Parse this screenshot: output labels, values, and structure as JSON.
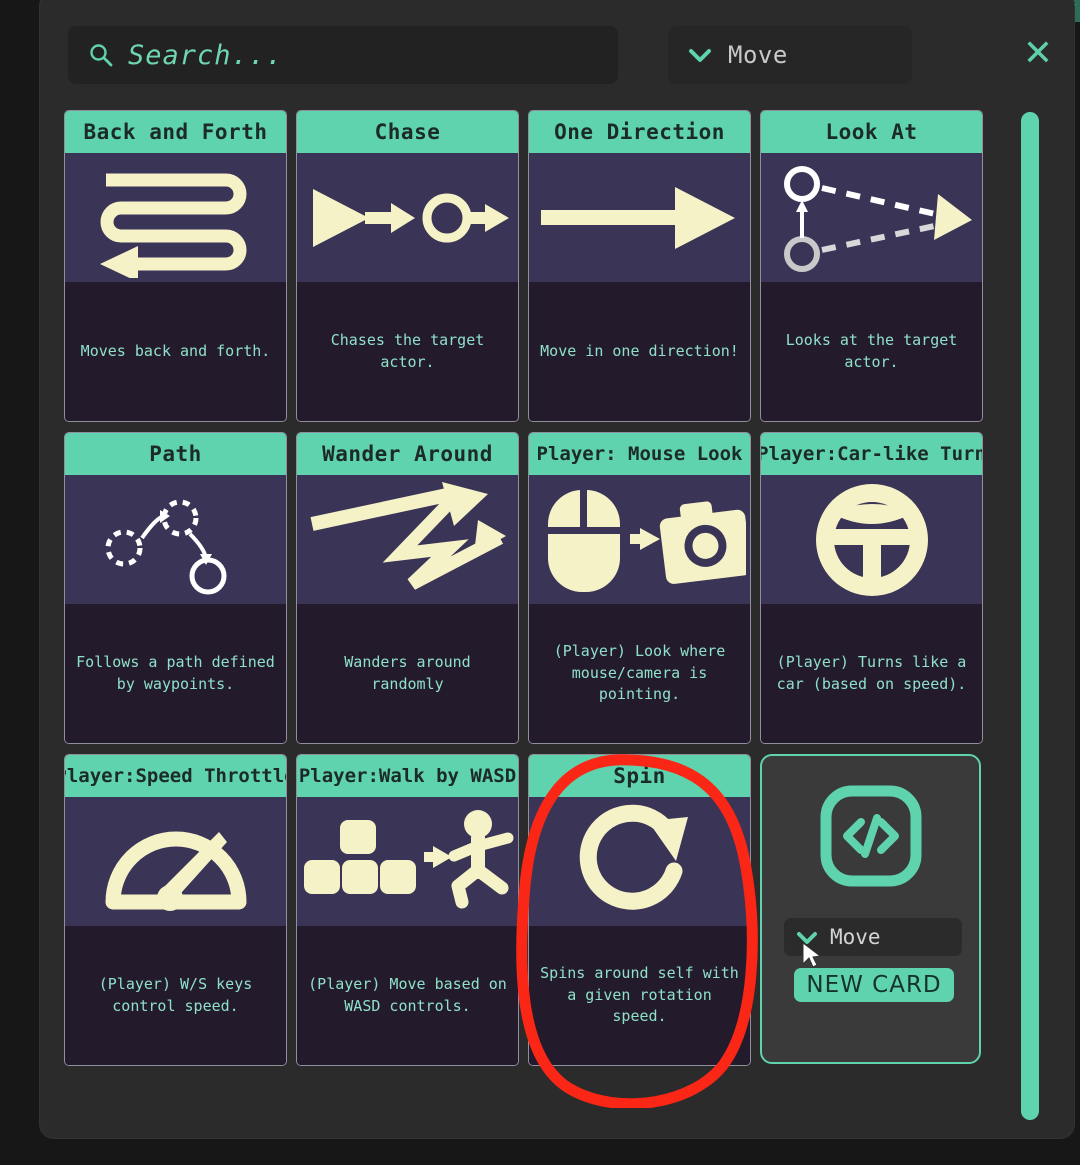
{
  "header": {
    "search_placeholder": "Search...",
    "search_value": "",
    "search_icon": "search-icon",
    "category_label": "Move",
    "category_icon": "chevron-down-icon",
    "close_label": "✕"
  },
  "colors": {
    "accent_teal": "#5fd2ae",
    "card_title_bg": "#5fd2ae",
    "card_art_bg": "#3a3456",
    "card_desc_bg": "#231b2c",
    "panel_bg": "#2b2b2b",
    "desc_text": "#8fe0c8",
    "art_cream": "#f5f2c8",
    "annotation_red": "#fa2616"
  },
  "cards": [
    {
      "title": "Back and Forth",
      "desc": "Moves back and forth.",
      "icon": "serpentine-arrow-icon"
    },
    {
      "title": "Chase",
      "desc": "Chases the target actor.",
      "icon": "chase-arrow-icon"
    },
    {
      "title": "One Direction",
      "desc": "Move in one direction!",
      "icon": "right-arrow-icon"
    },
    {
      "title": "Look At",
      "desc": "Looks at the target actor.",
      "icon": "look-at-icon"
    },
    {
      "title": "Path",
      "desc": "Follows a path defined by waypoints.",
      "icon": "waypoint-path-icon"
    },
    {
      "title": "Wander Around",
      "desc": "Wanders around randomly",
      "icon": "zigzag-arrow-icon"
    },
    {
      "title": "Player: Mouse Look",
      "desc": "(Player) Look where mouse/camera is pointing.",
      "icon": "mouse-camera-icon"
    },
    {
      "title": "Player:Car-like Turn",
      "desc": "(Player) Turns like a car (based on speed).",
      "icon": "steering-wheel-icon"
    },
    {
      "title": "Player:Speed Throttle",
      "desc": "(Player) W/S keys control speed.",
      "icon": "speedometer-icon"
    },
    {
      "title": "Player:Walk by WASD",
      "desc": "(Player) Move based on WASD controls.",
      "icon": "wasd-keys-runner-icon"
    },
    {
      "title": "Spin",
      "desc": "Spins around self with a given rotation speed.",
      "icon": "circular-arrow-icon"
    }
  ],
  "new_card": {
    "icon": "code-brackets-icon",
    "category_label": "Move",
    "category_icon": "chevron-down-icon",
    "button_label": "NEW CARD"
  }
}
